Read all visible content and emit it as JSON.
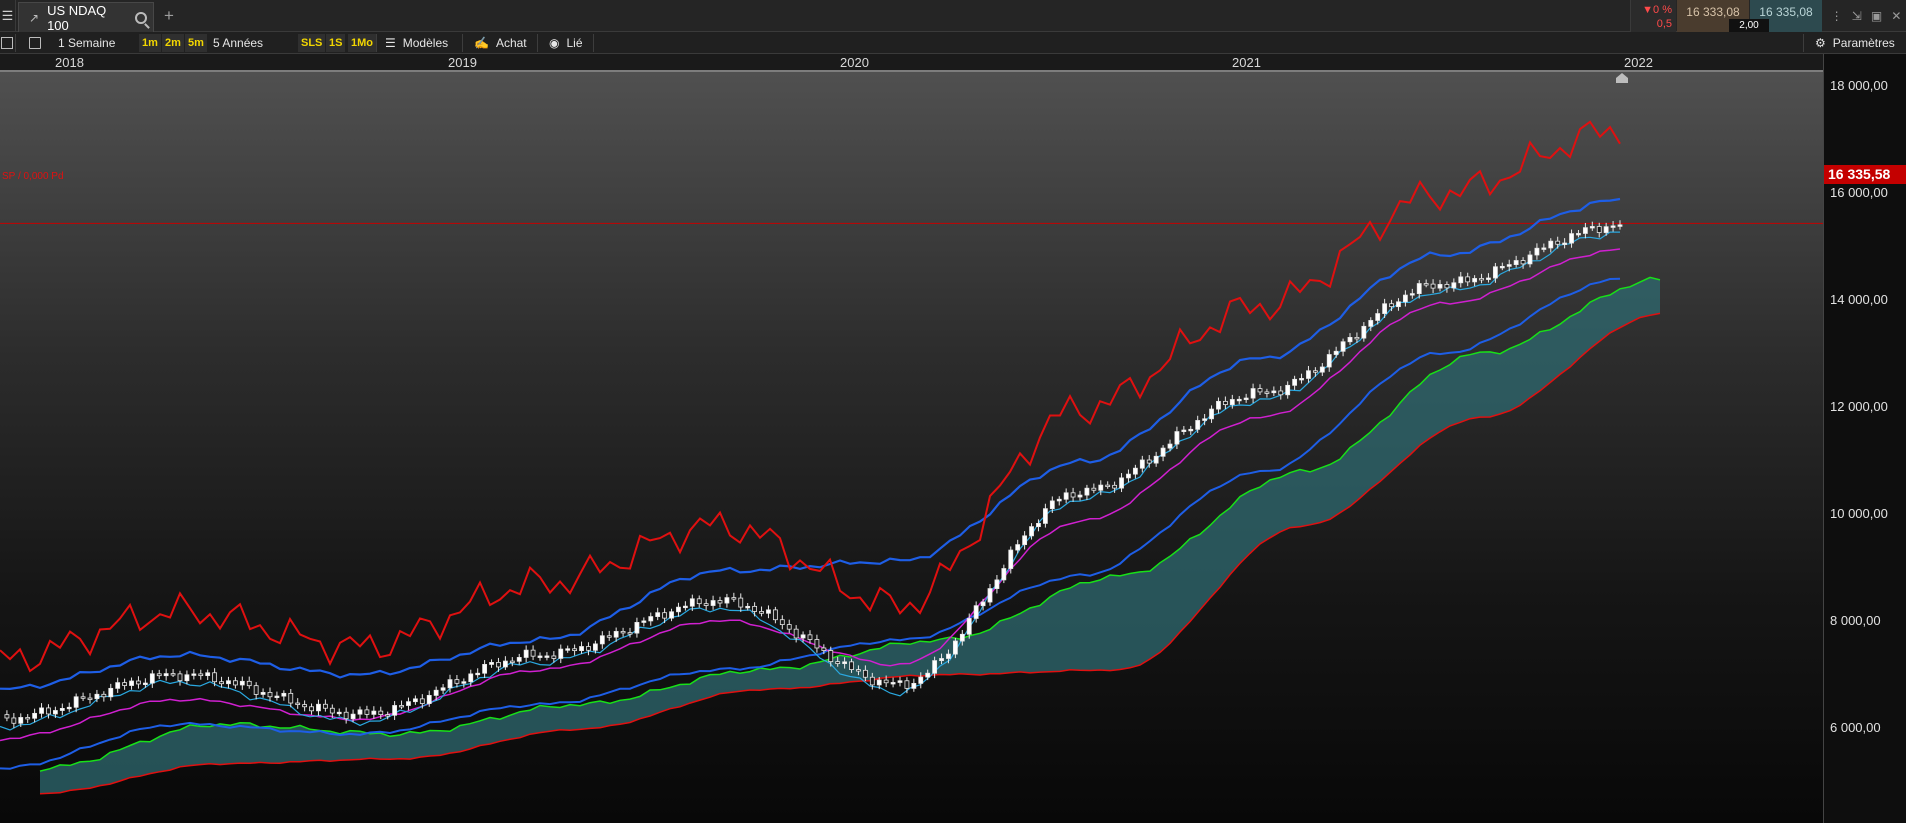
{
  "titlebar": {
    "tab_title": "US NDAQ 100",
    "change_pct": "▼0 %",
    "change_abs": "0,5",
    "bid": "16 333,08",
    "spread": "2,00",
    "ask": "16 335,08"
  },
  "toolbar": {
    "period": "1 Semaine",
    "interval_1m": "1m",
    "interval_2m": "2m",
    "interval_5m": "5m",
    "range": "5 Années",
    "sls": "SLS",
    "one_s": "1S",
    "one_mo": "1Mo",
    "models": "Modèles",
    "buy": "Achat",
    "linked": "Lié",
    "settings": "Paramètres"
  },
  "alert_label": "SP / 0,000 Pd",
  "price_label": "16 335,58",
  "colors": {
    "rsi_line": "#e01010",
    "boll_upper": "#1e5ee6",
    "kijun": "#1e5ee6",
    "tenkan": "#2aa8e0",
    "ma_purple": "#d020d0",
    "span_a": "#18e018",
    "span_b": "#e01010",
    "cloud": "#2f6a70",
    "price_line": "#c40000"
  },
  "chart_data": {
    "type": "line",
    "title": "",
    "x": [
      "2018-01",
      "2018-07",
      "2019-01",
      "2019-07",
      "2020-01",
      "2020-03",
      "2020-07",
      "2021-01",
      "2021-07",
      "2022-01"
    ],
    "x_ticks": [
      "2018",
      "2019",
      "2020",
      "2021",
      "2022"
    ],
    "y_ticks": [
      "18 000,00",
      "16 000,00",
      "14 000,00",
      "12 000,00",
      "10 000,00",
      "8 000,00",
      "6 000,00"
    ],
    "ylim": [
      4200,
      19400
    ],
    "current_price": 16335.58,
    "series": [
      {
        "values": [
          6300,
          7200,
          6400,
          7600,
          8700,
          7000,
          10900,
          12900,
          15100,
          16300
        ]
      },
      {
        "values": [
          6900,
          7600,
          7200,
          7900,
          9300,
          9500,
          11500,
          13600,
          15700,
          16800
        ]
      },
      {
        "values": [
          5900,
          6700,
          6300,
          7300,
          8300,
          7400,
          10300,
          12400,
          14700,
          15800
        ]
      },
      {
        "values": [
          5300,
          6200,
          6000,
          6600,
          7300,
          7900,
          9200,
          11300,
          13700,
          15200
        ]
      },
      {
        "values": [
          4800,
          5400,
          5500,
          6100,
          6900,
          7200,
          7300,
          10200,
          12400,
          14500
        ]
      }
    ]
  }
}
